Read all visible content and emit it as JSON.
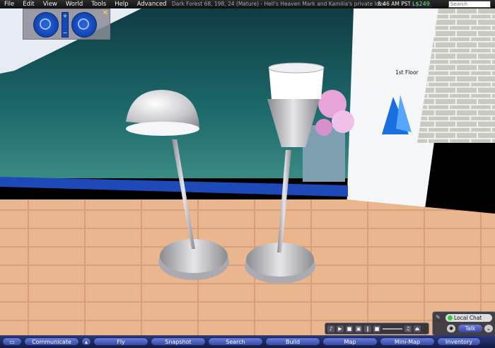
{
  "menubar": {
    "items": [
      "File",
      "Edit",
      "View",
      "World",
      "Tools",
      "Help",
      "Advanced"
    ],
    "location": "Dark Forest 68, 198, 24 (Mature) - Hell's Heaven Mark and Kamilia's private love",
    "clock": "8:46 AM PST",
    "balance": "L$249",
    "search_placeholder": "Search"
  },
  "camera": {
    "close": "✕",
    "zoom_in": "+",
    "zoom_out": "−"
  },
  "scene": {
    "floor_label": "1st Floor"
  },
  "bottombar": {
    "buttons": [
      "Communicate",
      "Fly",
      "Snapshot",
      "Search",
      "Build",
      "Map",
      "Mini-Map",
      "Inventory"
    ]
  },
  "chat": {
    "local_chat": "Local Chat",
    "talk": "Talk"
  },
  "icons": [
    "chat-bubble-icon",
    "music-note-icon",
    "play-icon",
    "media-icon",
    "pause-icon",
    "volume-icon",
    "eject-icon",
    "mic-icon",
    "chevron-down-icon",
    "arrow-icon"
  ]
}
